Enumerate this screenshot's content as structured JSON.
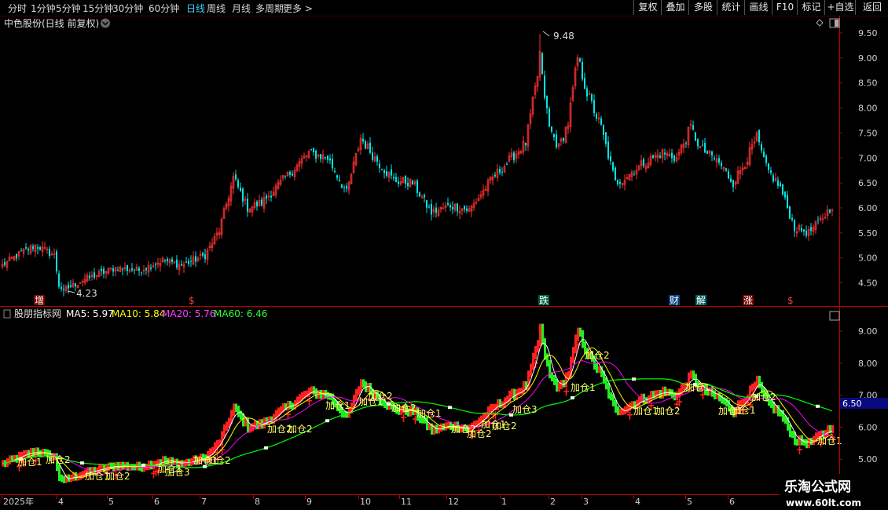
{
  "colors": {
    "bg": "#000000",
    "up": "#ff3232",
    "down": "#00e6e6",
    "grid": "#3c0000",
    "axis": "#c00000",
    "ma5": "#ffffff",
    "ma10": "#ffff00",
    "ma20": "#ff00ff",
    "ma60": "#00ff00",
    "ind_up": "#ff2020",
    "ind_down": "#22ee22",
    "label": "#ffff66",
    "price_tag_bg": "#0a0a80",
    "active_tab": "#3fd0ff"
  },
  "toolbar": {
    "periods": [
      "分时",
      "1分钟",
      "5分钟",
      "15分钟",
      "30分钟",
      "60分钟",
      "日线",
      "周线",
      "月线",
      "多周期",
      "更多 >"
    ],
    "active_period": "日线",
    "right_buttons": [
      "复权",
      "叠加",
      "多股",
      "统计",
      "画线",
      "F10",
      "标记",
      "+自选",
      "返回"
    ]
  },
  "main_chart": {
    "title": "中色股份(日线 前复权)",
    "high_label": "9.48",
    "low_label": "4.23",
    "y_ticks": [
      "9.50",
      "9.00",
      "8.50",
      "8.00",
      "7.50",
      "7.00",
      "6.50",
      "6.00",
      "5.50",
      "5.00",
      "4.50"
    ],
    "event_marks": [
      {
        "text": "增",
        "color": "#ffffff",
        "bg": "#7a0000"
      },
      {
        "text": "$",
        "color": "#ff4040",
        "bg": ""
      },
      {
        "text": "跌",
        "color": "#ffffff",
        "bg": "#006040"
      },
      {
        "text": "财",
        "color": "#ffffff",
        "bg": "#004080"
      },
      {
        "text": "解",
        "color": "#ffffff",
        "bg": "#006060"
      },
      {
        "text": "涨",
        "color": "#ffffff",
        "bg": "#7a0000"
      },
      {
        "text": "$",
        "color": "#ff4040",
        "bg": ""
      }
    ]
  },
  "indicator": {
    "name": "股朋指标网",
    "ma5": "MA5: 5.97",
    "ma10": "MA10: 5.84",
    "ma20": "MA20: 5.76",
    "ma60": "MA60: 6.46",
    "y_ticks": [
      "9.00",
      "8.00",
      "7.00",
      "6.00",
      "5.00"
    ],
    "price_tag": "6.50",
    "signals": [
      "加仓1",
      "加仓2",
      "加仓3"
    ]
  },
  "x_axis": {
    "labels": [
      "2025年",
      "4",
      "5",
      "6",
      "7",
      "8",
      "9",
      "10",
      "11",
      "12",
      "1",
      "2",
      "3",
      "4",
      "5",
      "6"
    ]
  },
  "watermark": {
    "title": "乐淘公式网",
    "url": "www.60lt.com"
  },
  "chart_data": {
    "type": "candlestick",
    "price_anchors": [
      {
        "i": 0,
        "p": 4.85
      },
      {
        "i": 8,
        "p": 5.1
      },
      {
        "i": 14,
        "p": 5.25
      },
      {
        "i": 22,
        "p": 5.05
      },
      {
        "i": 24,
        "p": 4.45
      },
      {
        "i": 26,
        "p": 4.35
      },
      {
        "i": 34,
        "p": 4.55
      },
      {
        "i": 48,
        "p": 4.8
      },
      {
        "i": 58,
        "p": 4.75
      },
      {
        "i": 68,
        "p": 4.95
      },
      {
        "i": 76,
        "p": 4.85
      },
      {
        "i": 86,
        "p": 5.05
      },
      {
        "i": 92,
        "p": 5.55
      },
      {
        "i": 98,
        "p": 6.6
      },
      {
        "i": 104,
        "p": 6.0
      },
      {
        "i": 110,
        "p": 6.1
      },
      {
        "i": 124,
        "p": 6.8
      },
      {
        "i": 130,
        "p": 7.1
      },
      {
        "i": 138,
        "p": 7.0
      },
      {
        "i": 146,
        "p": 6.3
      },
      {
        "i": 152,
        "p": 7.4
      },
      {
        "i": 158,
        "p": 7.0
      },
      {
        "i": 166,
        "p": 6.55
      },
      {
        "i": 174,
        "p": 6.5
      },
      {
        "i": 182,
        "p": 5.9
      },
      {
        "i": 190,
        "p": 6.05
      },
      {
        "i": 198,
        "p": 5.95
      },
      {
        "i": 208,
        "p": 6.6
      },
      {
        "i": 216,
        "p": 7.0
      },
      {
        "i": 222,
        "p": 7.3
      },
      {
        "i": 228,
        "p": 8.9
      },
      {
        "i": 232,
        "p": 7.6
      },
      {
        "i": 236,
        "p": 7.2
      },
      {
        "i": 240,
        "p": 7.7
      },
      {
        "i": 244,
        "p": 9.0
      },
      {
        "i": 248,
        "p": 8.3
      },
      {
        "i": 254,
        "p": 7.6
      },
      {
        "i": 260,
        "p": 6.5
      },
      {
        "i": 264,
        "p": 6.6
      },
      {
        "i": 272,
        "p": 6.9
      },
      {
        "i": 280,
        "p": 7.1
      },
      {
        "i": 286,
        "p": 7.0
      },
      {
        "i": 292,
        "p": 7.6
      },
      {
        "i": 296,
        "p": 7.2
      },
      {
        "i": 304,
        "p": 6.9
      },
      {
        "i": 310,
        "p": 6.5
      },
      {
        "i": 316,
        "p": 7.0
      },
      {
        "i": 320,
        "p": 7.4
      },
      {
        "i": 324,
        "p": 6.8
      },
      {
        "i": 330,
        "p": 6.4
      },
      {
        "i": 336,
        "p": 5.6
      },
      {
        "i": 342,
        "p": 5.5
      },
      {
        "i": 348,
        "p": 5.8
      },
      {
        "i": 352,
        "p": 6.05
      }
    ],
    "high": 9.48,
    "low": 4.23,
    "ylim": [
      4.2,
      9.75
    ]
  }
}
